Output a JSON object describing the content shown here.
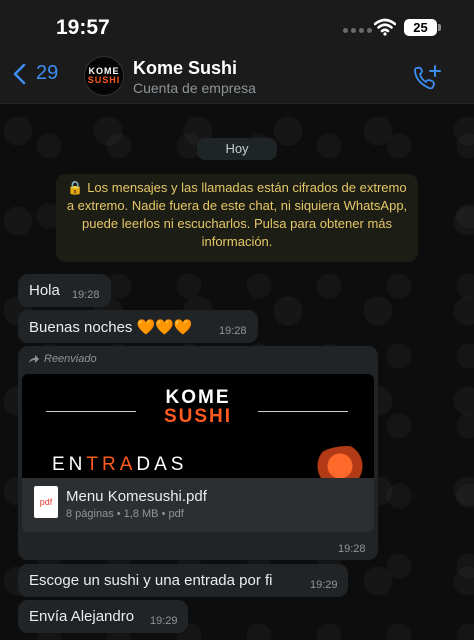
{
  "status_bar": {
    "time": "19:57",
    "battery": "25"
  },
  "header": {
    "back_count": "29",
    "avatar_line1": "KOME",
    "avatar_line2": "SUSHI",
    "contact_name": "Kome Sushi",
    "contact_subtitle": "Cuenta de empresa"
  },
  "chat": {
    "date_divider": "Hoy",
    "encryption_notice": "🔒 Los mensajes y las llamadas están cifrados de extremo a extremo. Nadie fuera de este chat, ni siquiera WhatsApp, puede leerlos ni escucharlos. Pulsa para obtener más información.",
    "messages": [
      {
        "text": "Hola",
        "time": "19:28"
      },
      {
        "text": "Buenas noches 🧡🧡🧡",
        "time": "19:28"
      },
      {
        "forwarded_label": "Reenviado",
        "preview_logo_top": "KOME",
        "preview_logo_bottom": "SUSHI",
        "preview_title_a": "EN",
        "preview_title_b": "TRA",
        "preview_title_c": "DAS",
        "file_icon_label": "pdf",
        "file_name": "Menu Komesushi.pdf",
        "file_meta": "8 páginas • 1,8 MB • pdf",
        "time": "19:28"
      },
      {
        "text": "Escoge un sushi y una entrada por fi",
        "time": "19:29"
      },
      {
        "text": "Envía Alejandro",
        "time": "19:29"
      }
    ]
  },
  "colors": {
    "accent": "#3d8cf0",
    "bubble": "#202426",
    "notice_text": "#e6c767",
    "brand_orange": "#ff5a1f"
  }
}
